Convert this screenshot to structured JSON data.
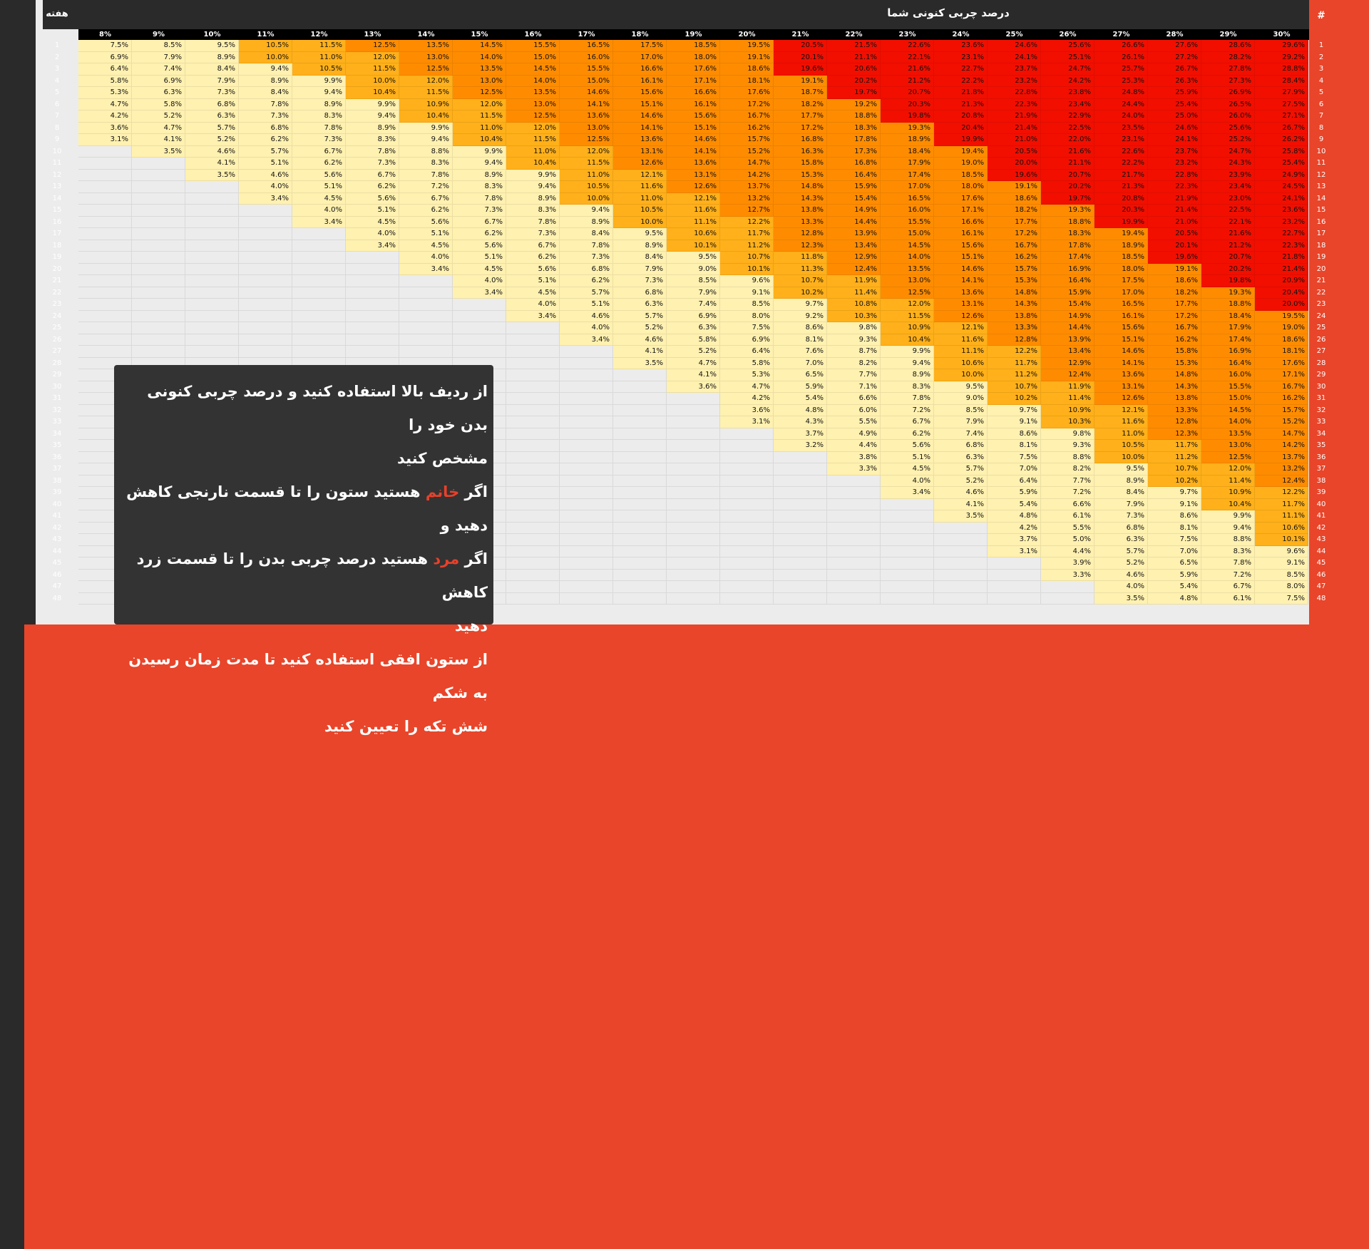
{
  "header": {
    "title": "درصد چربی کنونی شما",
    "week_label": "هفته",
    "hash_label": "#"
  },
  "columns": [
    "8%",
    "9%",
    "10%",
    "11%",
    "12%",
    "13%",
    "14%",
    "15%",
    "16%",
    "17%",
    "18%",
    "19%",
    "20%",
    "21%",
    "22%",
    "23%",
    "24%",
    "25%",
    "26%",
    "27%",
    "28%",
    "29%",
    "30%"
  ],
  "rows": [
    [
      "7.5%",
      "8.5%",
      "9.5%",
      "10.5%",
      "11.5%",
      "12.5%",
      "13.5%",
      "14.5%",
      "15.5%",
      "16.5%",
      "17.5%",
      "18.5%",
      "19.5%",
      "20.5%",
      "21.5%",
      "22.6%",
      "23.6%",
      "24.6%",
      "25.6%",
      "26.6%",
      "27.6%",
      "28.6%",
      "29.6%"
    ],
    [
      "6.9%",
      "7.9%",
      "8.9%",
      "10.0%",
      "11.0%",
      "12.0%",
      "13.0%",
      "14.0%",
      "15.0%",
      "16.0%",
      "17.0%",
      "18.0%",
      "19.1%",
      "20.1%",
      "21.1%",
      "22.1%",
      "23.1%",
      "24.1%",
      "25.1%",
      "26.1%",
      "27.2%",
      "28.2%",
      "29.2%"
    ],
    [
      "6.4%",
      "7.4%",
      "8.4%",
      "9.4%",
      "10.5%",
      "11.5%",
      "12.5%",
      "13.5%",
      "14.5%",
      "15.5%",
      "16.6%",
      "17.6%",
      "18.6%",
      "19.6%",
      "20.6%",
      "21.6%",
      "22.7%",
      "23.7%",
      "24.7%",
      "25.7%",
      "26.7%",
      "27.8%",
      "28.8%"
    ],
    [
      "5.8%",
      "6.9%",
      "7.9%",
      "8.9%",
      "9.9%",
      "10.0%",
      "12.0%",
      "13.0%",
      "14.0%",
      "15.0%",
      "16.1%",
      "17.1%",
      "18.1%",
      "19.1%",
      "20.2%",
      "21.2%",
      "22.2%",
      "23.2%",
      "24.2%",
      "25.3%",
      "26.3%",
      "27.3%",
      "28.4%"
    ],
    [
      "5.3%",
      "6.3%",
      "7.3%",
      "8.4%",
      "9.4%",
      "10.4%",
      "11.5%",
      "12.5%",
      "13.5%",
      "14.6%",
      "15.6%",
      "16.6%",
      "17.6%",
      "18.7%",
      "19.7%",
      "20.7%",
      "21.8%",
      "22.8%",
      "23.8%",
      "24.8%",
      "25.9%",
      "26.9%",
      "27.9%"
    ],
    [
      "4.7%",
      "5.8%",
      "6.8%",
      "7.8%",
      "8.9%",
      "9.9%",
      "10.9%",
      "12.0%",
      "13.0%",
      "14.1%",
      "15.1%",
      "16.1%",
      "17.2%",
      "18.2%",
      "19.2%",
      "20.3%",
      "21.3%",
      "22.3%",
      "23.4%",
      "24.4%",
      "25.4%",
      "26.5%",
      "27.5%"
    ],
    [
      "4.2%",
      "5.2%",
      "6.3%",
      "7.3%",
      "8.3%",
      "9.4%",
      "10.4%",
      "11.5%",
      "12.5%",
      "13.6%",
      "14.6%",
      "15.6%",
      "16.7%",
      "17.7%",
      "18.8%",
      "19.8%",
      "20.8%",
      "21.9%",
      "22.9%",
      "24.0%",
      "25.0%",
      "26.0%",
      "27.1%"
    ],
    [
      "3.6%",
      "4.7%",
      "5.7%",
      "6.8%",
      "7.8%",
      "8.9%",
      "9.9%",
      "11.0%",
      "12.0%",
      "13.0%",
      "14.1%",
      "15.1%",
      "16.2%",
      "17.2%",
      "18.3%",
      "19.3%",
      "20.4%",
      "21.4%",
      "22.5%",
      "23.5%",
      "24.6%",
      "25.6%",
      "26.7%"
    ],
    [
      "3.1%",
      "4.1%",
      "5.2%",
      "6.2%",
      "7.3%",
      "8.3%",
      "9.4%",
      "10.4%",
      "11.5%",
      "12.5%",
      "13.6%",
      "14.6%",
      "15.7%",
      "16.8%",
      "17.8%",
      "18.9%",
      "19.9%",
      "21.0%",
      "22.0%",
      "23.1%",
      "24.1%",
      "25.2%",
      "26.2%"
    ],
    [
      "",
      "3.5%",
      "4.6%",
      "5.7%",
      "6.7%",
      "7.8%",
      "8.8%",
      "9.9%",
      "11.0%",
      "12.0%",
      "13.1%",
      "14.1%",
      "15.2%",
      "16.3%",
      "17.3%",
      "18.4%",
      "19.4%",
      "20.5%",
      "21.6%",
      "22.6%",
      "23.7%",
      "24.7%",
      "25.8%"
    ],
    [
      "",
      "",
      "4.1%",
      "5.1%",
      "6.2%",
      "7.3%",
      "8.3%",
      "9.4%",
      "10.4%",
      "11.5%",
      "12.6%",
      "13.6%",
      "14.7%",
      "15.8%",
      "16.8%",
      "17.9%",
      "19.0%",
      "20.0%",
      "21.1%",
      "22.2%",
      "23.2%",
      "24.3%",
      "25.4%"
    ],
    [
      "",
      "",
      "3.5%",
      "4.6%",
      "5.6%",
      "6.7%",
      "7.8%",
      "8.9%",
      "9.9%",
      "11.0%",
      "12.1%",
      "13.1%",
      "14.2%",
      "15.3%",
      "16.4%",
      "17.4%",
      "18.5%",
      "19.6%",
      "20.7%",
      "21.7%",
      "22.8%",
      "23.9%",
      "24.9%"
    ],
    [
      "",
      "",
      "",
      "4.0%",
      "5.1%",
      "6.2%",
      "7.2%",
      "8.3%",
      "9.4%",
      "10.5%",
      "11.6%",
      "12.6%",
      "13.7%",
      "14.8%",
      "15.9%",
      "17.0%",
      "18.0%",
      "19.1%",
      "20.2%",
      "21.3%",
      "22.3%",
      "23.4%",
      "24.5%"
    ],
    [
      "",
      "",
      "",
      "3.4%",
      "4.5%",
      "5.6%",
      "6.7%",
      "7.8%",
      "8.9%",
      "10.0%",
      "11.0%",
      "12.1%",
      "13.2%",
      "14.3%",
      "15.4%",
      "16.5%",
      "17.6%",
      "18.6%",
      "19.7%",
      "20.8%",
      "21.9%",
      "23.0%",
      "24.1%"
    ],
    [
      "",
      "",
      "",
      "",
      "4.0%",
      "5.1%",
      "6.2%",
      "7.3%",
      "8.3%",
      "9.4%",
      "10.5%",
      "11.6%",
      "12.7%",
      "13.8%",
      "14.9%",
      "16.0%",
      "17.1%",
      "18.2%",
      "19.3%",
      "20.3%",
      "21.4%",
      "22.5%",
      "23.6%"
    ],
    [
      "",
      "",
      "",
      "",
      "3.4%",
      "4.5%",
      "5.6%",
      "6.7%",
      "7.8%",
      "8.9%",
      "10.0%",
      "11.1%",
      "12.2%",
      "13.3%",
      "14.4%",
      "15.5%",
      "16.6%",
      "17.7%",
      "18.8%",
      "19.9%",
      "21.0%",
      "22.1%",
      "23.2%"
    ],
    [
      "",
      "",
      "",
      "",
      "",
      "4.0%",
      "5.1%",
      "6.2%",
      "7.3%",
      "8.4%",
      "9.5%",
      "10.6%",
      "11.7%",
      "12.8%",
      "13.9%",
      "15.0%",
      "16.1%",
      "17.2%",
      "18.3%",
      "19.4%",
      "20.5%",
      "21.6%",
      "22.7%"
    ],
    [
      "",
      "",
      "",
      "",
      "",
      "3.4%",
      "4.5%",
      "5.6%",
      "6.7%",
      "7.8%",
      "8.9%",
      "10.1%",
      "11.2%",
      "12.3%",
      "13.4%",
      "14.5%",
      "15.6%",
      "16.7%",
      "17.8%",
      "18.9%",
      "20.1%",
      "21.2%",
      "22.3%"
    ],
    [
      "",
      "",
      "",
      "",
      "",
      "",
      "4.0%",
      "5.1%",
      "6.2%",
      "7.3%",
      "8.4%",
      "9.5%",
      "10.7%",
      "11.8%",
      "12.9%",
      "14.0%",
      "15.1%",
      "16.2%",
      "17.4%",
      "18.5%",
      "19.6%",
      "20.7%",
      "21.8%"
    ],
    [
      "",
      "",
      "",
      "",
      "",
      "",
      "3.4%",
      "4.5%",
      "5.6%",
      "6.8%",
      "7.9%",
      "9.0%",
      "10.1%",
      "11.3%",
      "12.4%",
      "13.5%",
      "14.6%",
      "15.7%",
      "16.9%",
      "18.0%",
      "19.1%",
      "20.2%",
      "21.4%"
    ],
    [
      "",
      "",
      "",
      "",
      "",
      "",
      "",
      "4.0%",
      "5.1%",
      "6.2%",
      "7.3%",
      "8.5%",
      "9.6%",
      "10.7%",
      "11.9%",
      "13.0%",
      "14.1%",
      "15.3%",
      "16.4%",
      "17.5%",
      "18.6%",
      "19.8%",
      "20.9%"
    ],
    [
      "",
      "",
      "",
      "",
      "",
      "",
      "",
      "3.4%",
      "4.5%",
      "5.7%",
      "6.8%",
      "7.9%",
      "9.1%",
      "10.2%",
      "11.4%",
      "12.5%",
      "13.6%",
      "14.8%",
      "15.9%",
      "17.0%",
      "18.2%",
      "19.3%",
      "20.4%"
    ],
    [
      "",
      "",
      "",
      "",
      "",
      "",
      "",
      "",
      "4.0%",
      "5.1%",
      "6.3%",
      "7.4%",
      "8.5%",
      "9.7%",
      "10.8%",
      "12.0%",
      "13.1%",
      "14.3%",
      "15.4%",
      "16.5%",
      "17.7%",
      "18.8%",
      "20.0%"
    ],
    [
      "",
      "",
      "",
      "",
      "",
      "",
      "",
      "",
      "3.4%",
      "4.6%",
      "5.7%",
      "6.9%",
      "8.0%",
      "9.2%",
      "10.3%",
      "11.5%",
      "12.6%",
      "13.8%",
      "14.9%",
      "16.1%",
      "17.2%",
      "18.4%",
      "19.5%"
    ],
    [
      "",
      "",
      "",
      "",
      "",
      "",
      "",
      "",
      "",
      "4.0%",
      "5.2%",
      "6.3%",
      "7.5%",
      "8.6%",
      "9.8%",
      "10.9%",
      "12.1%",
      "13.3%",
      "14.4%",
      "15.6%",
      "16.7%",
      "17.9%",
      "19.0%"
    ],
    [
      "",
      "",
      "",
      "",
      "",
      "",
      "",
      "",
      "",
      "3.4%",
      "4.6%",
      "5.8%",
      "6.9%",
      "8.1%",
      "9.3%",
      "10.4%",
      "11.6%",
      "12.8%",
      "13.9%",
      "15.1%",
      "16.2%",
      "17.4%",
      "18.6%"
    ],
    [
      "",
      "",
      "",
      "",
      "",
      "",
      "",
      "",
      "",
      "",
      "4.1%",
      "5.2%",
      "6.4%",
      "7.6%",
      "8.7%",
      "9.9%",
      "11.1%",
      "12.2%",
      "13.4%",
      "14.6%",
      "15.8%",
      "16.9%",
      "18.1%"
    ],
    [
      "",
      "",
      "",
      "",
      "",
      "",
      "",
      "",
      "",
      "",
      "3.5%",
      "4.7%",
      "5.8%",
      "7.0%",
      "8.2%",
      "9.4%",
      "10.6%",
      "11.7%",
      "12.9%",
      "14.1%",
      "15.3%",
      "16.4%",
      "17.6%"
    ],
    [
      "",
      "",
      "",
      "",
      "",
      "",
      "",
      "",
      "",
      "",
      "",
      "4.1%",
      "5.3%",
      "6.5%",
      "7.7%",
      "8.9%",
      "10.0%",
      "11.2%",
      "12.4%",
      "13.6%",
      "14.8%",
      "16.0%",
      "17.1%"
    ],
    [
      "",
      "",
      "",
      "",
      "",
      "",
      "",
      "",
      "",
      "",
      "",
      "3.6%",
      "4.7%",
      "5.9%",
      "7.1%",
      "8.3%",
      "9.5%",
      "10.7%",
      "11.9%",
      "13.1%",
      "14.3%",
      "15.5%",
      "16.7%"
    ],
    [
      "",
      "",
      "",
      "",
      "",
      "",
      "",
      "",
      "",
      "",
      "",
      "",
      "4.2%",
      "5.4%",
      "6.6%",
      "7.8%",
      "9.0%",
      "10.2%",
      "11.4%",
      "12.6%",
      "13.8%",
      "15.0%",
      "16.2%"
    ],
    [
      "",
      "",
      "",
      "",
      "",
      "",
      "",
      "",
      "",
      "",
      "",
      "",
      "3.6%",
      "4.8%",
      "6.0%",
      "7.2%",
      "8.5%",
      "9.7%",
      "10.9%",
      "12.1%",
      "13.3%",
      "14.5%",
      "15.7%"
    ],
    [
      "",
      "",
      "",
      "",
      "",
      "",
      "",
      "",
      "",
      "",
      "",
      "",
      "3.1%",
      "4.3%",
      "5.5%",
      "6.7%",
      "7.9%",
      "9.1%",
      "10.3%",
      "11.6%",
      "12.8%",
      "14.0%",
      "15.2%"
    ],
    [
      "",
      "",
      "",
      "",
      "",
      "",
      "",
      "",
      "",
      "",
      "",
      "",
      "",
      "3.7%",
      "4.9%",
      "6.2%",
      "7.4%",
      "8.6%",
      "9.8%",
      "11.0%",
      "12.3%",
      "13.5%",
      "14.7%"
    ],
    [
      "",
      "",
      "",
      "",
      "",
      "",
      "",
      "",
      "",
      "",
      "",
      "",
      "",
      "3.2%",
      "4.4%",
      "5.6%",
      "6.8%",
      "8.1%",
      "9.3%",
      "10.5%",
      "11.7%",
      "13.0%",
      "14.2%"
    ],
    [
      "",
      "",
      "",
      "",
      "",
      "",
      "",
      "",
      "",
      "",
      "",
      "",
      "",
      "",
      "3.8%",
      "5.1%",
      "6.3%",
      "7.5%",
      "8.8%",
      "10.0%",
      "11.2%",
      "12.5%",
      "13.7%"
    ],
    [
      "",
      "",
      "",
      "",
      "",
      "",
      "",
      "",
      "",
      "",
      "",
      "",
      "",
      "",
      "3.3%",
      "4.5%",
      "5.7%",
      "7.0%",
      "8.2%",
      "9.5%",
      "10.7%",
      "12.0%",
      "13.2%"
    ],
    [
      "",
      "",
      "",
      "",
      "",
      "",
      "",
      "",
      "",
      "",
      "",
      "",
      "",
      "",
      "",
      "4.0%",
      "5.2%",
      "6.4%",
      "7.7%",
      "8.9%",
      "10.2%",
      "11.4%",
      "12.4%"
    ],
    [
      "",
      "",
      "",
      "",
      "",
      "",
      "",
      "",
      "",
      "",
      "",
      "",
      "",
      "",
      "",
      "3.4%",
      "4.6%",
      "5.9%",
      "7.2%",
      "8.4%",
      "9.7%",
      "10.9%",
      "12.2%"
    ],
    [
      "",
      "",
      "",
      "",
      "",
      "",
      "",
      "",
      "",
      "",
      "",
      "",
      "",
      "",
      "",
      "",
      "4.1%",
      "5.4%",
      "6.6%",
      "7.9%",
      "9.1%",
      "10.4%",
      "11.7%"
    ],
    [
      "",
      "",
      "",
      "",
      "",
      "",
      "",
      "",
      "",
      "",
      "",
      "",
      "",
      "",
      "",
      "",
      "3.5%",
      "4.8%",
      "6.1%",
      "7.3%",
      "8.6%",
      "9.9%",
      "11.1%"
    ],
    [
      "",
      "",
      "",
      "",
      "",
      "",
      "",
      "",
      "",
      "",
      "",
      "",
      "",
      "",
      "",
      "",
      "",
      "4.2%",
      "5.5%",
      "6.8%",
      "8.1%",
      "9.4%",
      "10.6%"
    ],
    [
      "",
      "",
      "",
      "",
      "",
      "",
      "",
      "",
      "",
      "",
      "",
      "",
      "",
      "",
      "",
      "",
      "",
      "3.7%",
      "5.0%",
      "6.3%",
      "7.5%",
      "8.8%",
      "10.1%"
    ],
    [
      "",
      "",
      "",
      "",
      "",
      "",
      "",
      "",
      "",
      "",
      "",
      "",
      "",
      "",
      "",
      "",
      "",
      "3.1%",
      "4.4%",
      "5.7%",
      "7.0%",
      "8.3%",
      "9.6%"
    ],
    [
      "",
      "",
      "",
      "",
      "",
      "",
      "",
      "",
      "",
      "",
      "",
      "",
      "",
      "",
      "",
      "",
      "",
      "",
      "3.9%",
      "5.2%",
      "6.5%",
      "7.8%",
      "9.1%"
    ],
    [
      "",
      "",
      "",
      "",
      "",
      "",
      "",
      "",
      "",
      "",
      "",
      "",
      "",
      "",
      "",
      "",
      "",
      "",
      "3.3%",
      "4.6%",
      "5.9%",
      "7.2%",
      "8.5%"
    ],
    [
      "",
      "",
      "",
      "",
      "",
      "",
      "",
      "",
      "",
      "",
      "",
      "",
      "",
      "",
      "",
      "",
      "",
      "",
      "",
      "4.0%",
      "5.4%",
      "6.7%",
      "8.0%"
    ],
    [
      "",
      "",
      "",
      "",
      "",
      "",
      "",
      "",
      "",
      "",
      "",
      "",
      "",
      "",
      "",
      "",
      "",
      "",
      "",
      "3.5%",
      "4.8%",
      "6.1%",
      "7.5%"
    ]
  ],
  "colors": {
    "empty": "#ececec",
    "yellow": "#fff1b0",
    "light_orange": "#ffb01a",
    "orange": "#ff8c00",
    "red": "#f20f00",
    "header": "#2a2a2a",
    "background": "#e8452a"
  },
  "note": {
    "line1": "از ردیف بالا استفاده کنید و درصد چربی کنونی بدن خود را",
    "line2": "مشخص کنید",
    "line3_pre": "اگر ",
    "line3_hl": "خانم",
    "line3_post": " هستید ستون را تا قسمت نارنجی کاهش دهید و",
    "line4_pre": "اگر ",
    "line4_hl": "مرد",
    "line4_post": " هستید درصد چربی بدن را تا قسمت زرد کاهش",
    "line5": "دهید",
    "line6": "از ستون افقی استفاده کنید تا مدت زمان رسیدن به شکم",
    "line7": "شش تکه را تعیین کنید"
  }
}
